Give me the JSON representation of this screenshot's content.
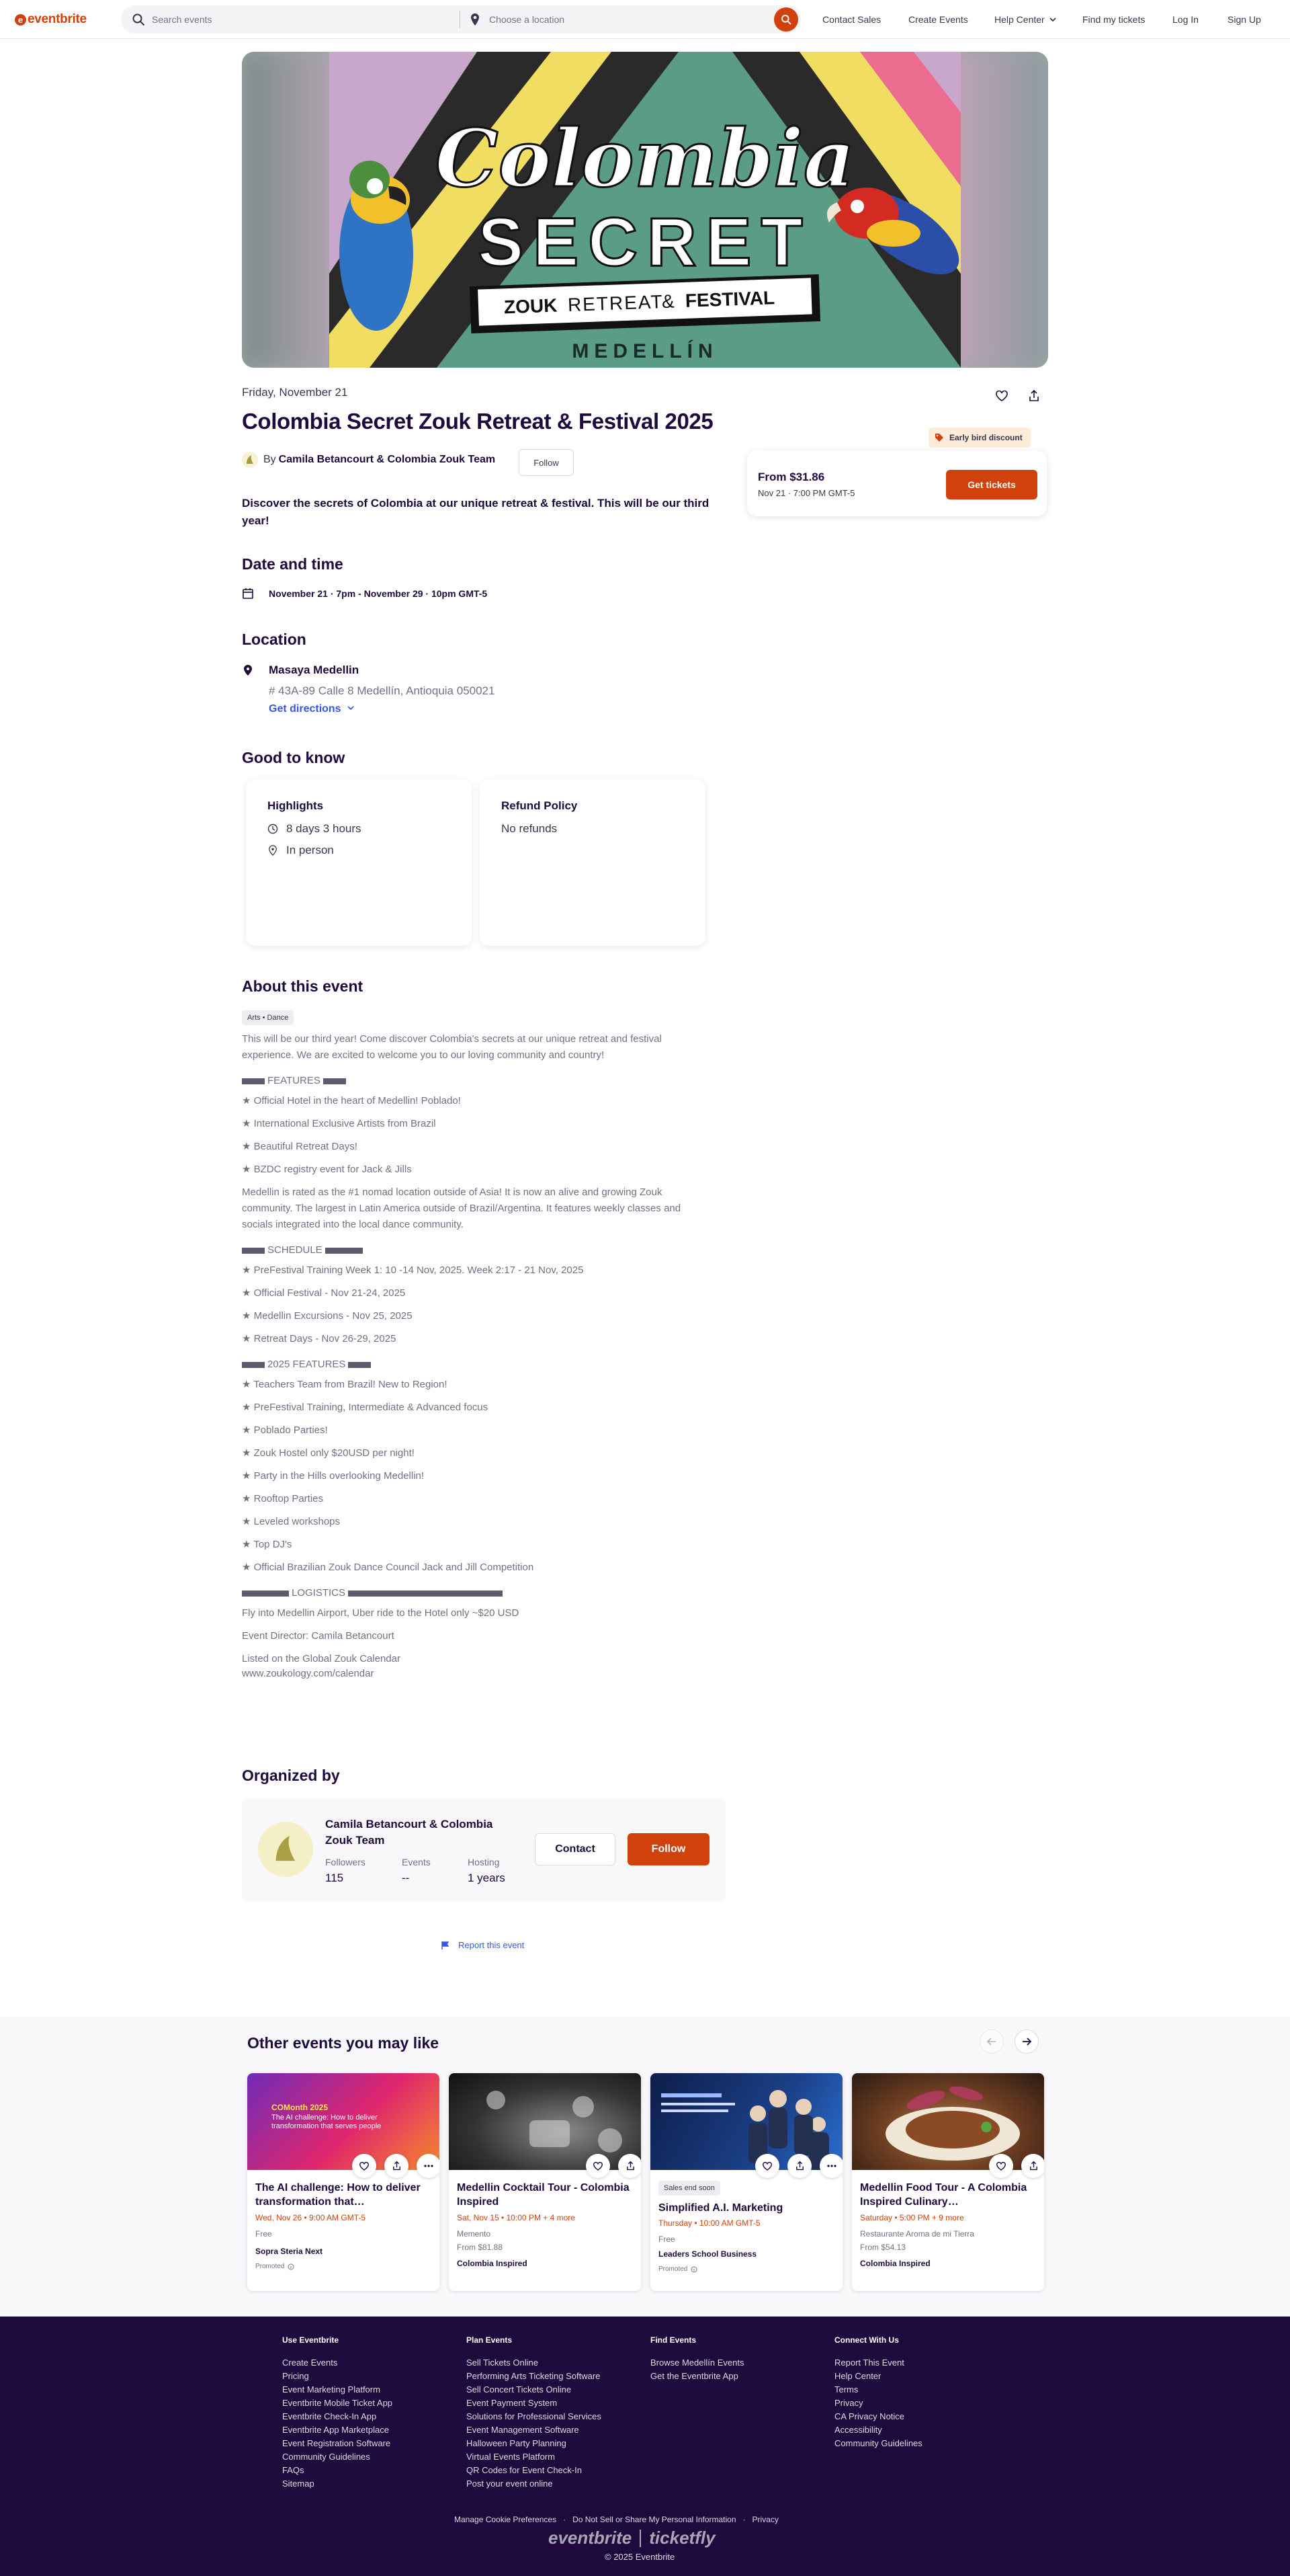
{
  "header": {
    "logo": "eventbrite",
    "search_placeholder": "Search events",
    "location_placeholder": "Choose a location",
    "nav": [
      "Contact Sales",
      "Create Events",
      "Help Center",
      "Find my tickets",
      "Log In",
      "Sign Up"
    ]
  },
  "hero": {
    "line1": "Colombia",
    "line2": "SECRET",
    "line3a": "ZOUK",
    "line3b": "RETREAT",
    "line3c": "&",
    "line3d": "FESTIVAL",
    "city": "MEDELLÍN"
  },
  "event": {
    "date_line": "Friday, November 21",
    "title": "Colombia Secret Zouk Retreat & Festival 2025",
    "by": "By",
    "organizer": "Camila Betancourt & Colombia Zouk Team",
    "follow": "Follow",
    "summary": "Discover the secrets of Colombia at our unique retreat & festival. This will be our third year!"
  },
  "ticket": {
    "badge": "Early bird discount",
    "price": "From $31.86",
    "date": "Nov 21 · 7:00 PM GMT-5",
    "button": "Get tickets"
  },
  "date_time": {
    "heading": "Date and time",
    "value": "November 21 · 7pm - November 29 · 10pm GMT-5"
  },
  "location": {
    "heading": "Location",
    "name": "Masaya Medellin",
    "address": "# 43A-89 Calle 8 Medellín, Antioquia 050021",
    "directions": "Get directions"
  },
  "good_to_know": {
    "heading": "Good to know",
    "highlights_title": "Highlights",
    "duration": "8 days 3 hours",
    "mode": "In person",
    "refund_title": "Refund Policy",
    "refund": "No refunds"
  },
  "about": {
    "heading": "About this event",
    "tag": "Arts • Dance",
    "intro": "This will be our third year! Come discover Colombia's secrets at our unique retreat and festival experience. We are excited to welcome you to our loving community and country!",
    "features_h": "FEATURES",
    "features": [
      "★ Official Hotel in the heart of Medellin! Poblado!",
      "★ International Exclusive Artists from Brazil",
      "★ Beautiful Retreat Days!",
      "★ BZDC registry event for Jack & Jills"
    ],
    "medellin": "Medellin is rated as the #1 nomad location outside of Asia! It is now an alive and growing Zouk community. The largest in Latin America outside of Brazil/Argentina. It features weekly classes and socials integrated into the local dance community.",
    "schedule_h": "SCHEDULE",
    "schedule": [
      "★ PreFestival Training Week 1: 10 -14 Nov, 2025. Week 2:17 - 21 Nov, 2025",
      "★ Official Festival - Nov 21-24, 2025",
      "★ Medellin Excursions - Nov 25, 2025",
      "★ Retreat Days - Nov 26-29, 2025"
    ],
    "features2025_h": "2025 FEATURES",
    "features2025": [
      "★ Teachers Team from Brazil! New to Region!",
      "★ PreFestival Training, Intermediate & Advanced focus",
      "★ Poblado Parties!",
      "★ Zouk Hostel only $20USD per night!",
      "★ Party in the Hills overlooking Medellin!",
      "★ Rooftop Parties",
      "★ Leveled workshops",
      "★ Top DJ's",
      "★ Official Brazilian Zouk Dance Council Jack and Jill Competition"
    ],
    "logistics_h": "LOGISTICS",
    "logistics": "Fly into Medellin Airport, Uber ride to the Hotel only ~$20 USD",
    "director": "Event Director: Camila Betancourt",
    "listed1": "Listed on the Global Zouk Calendar",
    "listed2": "www.zoukology.com/calendar"
  },
  "organizer_card": {
    "heading": "Organized by",
    "name": "Camila Betancourt & Colombia Zouk Team",
    "followers_l": "Followers",
    "followers_v": "115",
    "events_l": "Events",
    "events_v": "--",
    "hosting_l": "Hosting",
    "hosting_v": "1 years",
    "contact": "Contact",
    "follow": "Follow"
  },
  "report": "Report this event",
  "others": {
    "heading": "Other events you may like",
    "cards": [
      {
        "title": "The AI challenge: How to deliver transformation that…",
        "date": "Wed, Nov 26 • 9:00 AM GMT-5",
        "sub1": "Free",
        "org": "Sopra Steria Next",
        "promoted": "Promoted",
        "img_brand": "COMonth 2025",
        "img_text": "The AI challenge: How to deliver transformation that serves people"
      },
      {
        "title": "Medellin Cocktail Tour - Colombia Inspired",
        "date": "Sat, Nov 15 • 10:00 PM + 4 more",
        "sub1": "Memento",
        "sub2": "From $81.88",
        "org": "Colombia Inspired"
      },
      {
        "badge": "Sales end soon",
        "title": "Simplified A.I. Marketing",
        "date": "Thursday • 10:00 AM GMT-5",
        "sub1": "Free",
        "org": "Leaders School Business",
        "promoted": "Promoted"
      },
      {
        "title": "Medellin Food Tour - A Colombia Inspired Culinary…",
        "date": "Saturday • 5:00 PM + 9 more",
        "sub1": "Restaurante Aroma de mi Tierra",
        "sub2": "From $54.13",
        "org": "Colombia Inspired"
      }
    ]
  },
  "footer": {
    "cols": [
      {
        "h": "Use Eventbrite",
        "items": [
          "Create Events",
          "Pricing",
          "Event Marketing Platform",
          "Eventbrite Mobile Ticket App",
          "Eventbrite Check-In App",
          "Eventbrite App Marketplace",
          "Event Registration Software",
          "Community Guidelines",
          "FAQs",
          "Sitemap"
        ]
      },
      {
        "h": "Plan Events",
        "items": [
          "Sell Tickets Online",
          "Performing Arts Ticketing Software",
          "Sell Concert Tickets Online",
          "Event Payment System",
          "Solutions for Professional Services",
          "Event Management Software",
          "Halloween Party Planning",
          "Virtual Events Platform",
          "QR Codes for Event Check-In",
          "Post your event online"
        ]
      },
      {
        "h": "Find Events",
        "items": [
          "Browse Medellín Events",
          "Get the Eventbrite App"
        ]
      },
      {
        "h": "Connect With Us",
        "items": [
          "Report This Event",
          "Help Center",
          "Terms",
          "Privacy",
          "CA Privacy Notice",
          "Accessibility",
          "Community Guidelines"
        ]
      }
    ],
    "bottom_links": [
      "Manage Cookie Preferences",
      "Do Not Sell or Share My Personal Information",
      "Privacy"
    ],
    "brand1": "eventbrite",
    "brand2": "ticketfly",
    "copyright": "© 2025 Eventbrite"
  },
  "colors": {
    "brand": "#d1410c",
    "link": "#3659e3",
    "footer": "#1e0a3c",
    "text": "#1e0a3c"
  }
}
